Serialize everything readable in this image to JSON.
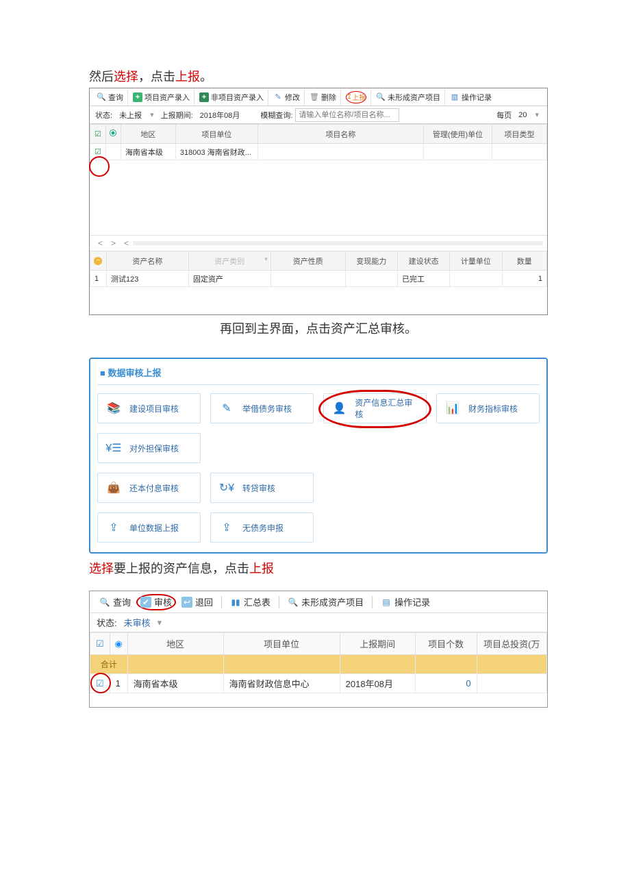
{
  "caption1_pre": "然后",
  "caption1_mid1": "选择",
  "caption1_mid2": "，点击",
  "caption1_mid3": "上报",
  "caption1_end": "。",
  "caption2": "再回到主界面，点击资产汇总审核。",
  "caption3_a": "选择",
  "caption3_b": "要上报的资产信息，点击",
  "caption3_c": "上报",
  "s1": {
    "toolbar": {
      "query": "查询",
      "add_proj_asset": "项目资产录入",
      "add_nonproj_asset": "非项目资产录入",
      "edit": "修改",
      "delete": "删除",
      "report": "上报",
      "unformed": "未形成资产项目",
      "log": "操作记录"
    },
    "filter": {
      "status_label": "状态:",
      "status_value": "未上报",
      "period_label": "上报期间:",
      "period_value": "2018年08月",
      "fuzzy_label": "模糊查询:",
      "fuzzy_placeholder": "请输入单位名称/项目名称...",
      "per_page_label": "每页",
      "per_page_value": "20"
    },
    "upper_cols": {
      "region": "地区",
      "unit": "项目单位",
      "name": "项目名称",
      "mgr_unit": "管理(使用)单位",
      "type": "项目类型"
    },
    "upper_row": {
      "region": "海南省本级",
      "unit": "318003 海南省财政..."
    },
    "lower_cols": {
      "asset_name": "资产名称",
      "asset_cat": "资产类别",
      "asset_nature": "资产性质",
      "realize": "变现能力",
      "build_status": "建设状态",
      "unit": "计量单位",
      "qty": "数量"
    },
    "lower_row": {
      "idx": "1",
      "name": "测试123",
      "cat": "固定资产",
      "nature": "",
      "realize": "",
      "status": "已完工",
      "unit": "",
      "qty": "1"
    }
  },
  "s2": {
    "title": "■ 数据审核上报",
    "tiles": {
      "build": "建设项目审核",
      "borrow": "举借债务审核",
      "asset_sum": "资产信息汇总审核",
      "fin_idx": "财务指标审核",
      "guarantee": "对外担保审核",
      "debt_pay": "还本付息审核",
      "transfer": "转贷审核",
      "unit_report": "单位数据上报",
      "no_debt": "无债务申报"
    }
  },
  "s3": {
    "toolbar": {
      "query": "查询",
      "audit": "审核",
      "ret": "退回",
      "sum": "汇总表",
      "unformed": "未形成资产项目",
      "log": "操作记录"
    },
    "filter": {
      "status_label": "状态:",
      "status_value": "未审核"
    },
    "cols": {
      "region": "地区",
      "unit": "项目单位",
      "period": "上报期间",
      "count": "项目个数",
      "invest": "项目总投资(万"
    },
    "sum_label": "合计",
    "row": {
      "idx": "1",
      "region": "海南省本级",
      "unit": "海南省财政信息中心",
      "period": "2018年08月",
      "count": "0",
      "invest": ""
    }
  }
}
